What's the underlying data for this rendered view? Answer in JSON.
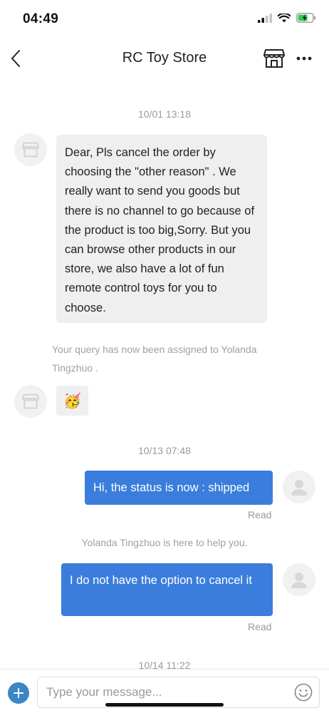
{
  "status_bar": {
    "time": "04:49",
    "icons": [
      "cellular-signal-icon",
      "wifi-icon",
      "battery-charging-icon"
    ]
  },
  "nav": {
    "back_icon": "chevron-left-icon",
    "title": "RC Toy Store",
    "store_icon": "store-icon",
    "more_icon": "more-dots-icon"
  },
  "messages": {
    "ts1": "10/01 13:18",
    "store_message": "Dear, Pls cancel the order by choosing the \"other reason\" . We really want to send you goods but there is no channel to go because of the product is too big,Sorry. But you can browse other products in our store, we also have a lot of fun remote control toys for you to choose.",
    "assigned_note": "Your query has now been assigned to Yolanda Tingzhuo .",
    "emoji_reply": "🥳",
    "ts2": "10/13 07:48",
    "user_msg1": "Hi, the status is now : shipped",
    "read1": "Read",
    "help_note": "Yolanda Tingzhuo is here to help you.",
    "user_msg2": "I do not have the option to cancel it",
    "read2": "Read",
    "ts3": "10/14 11:22"
  },
  "input": {
    "placeholder": "Type your message...",
    "value": ""
  },
  "colors": {
    "accent": "#3b7ddd",
    "plus_button": "#3b86c5",
    "incoming_bubble": "#efefef",
    "timestamp_text": "#9a9a9a"
  }
}
